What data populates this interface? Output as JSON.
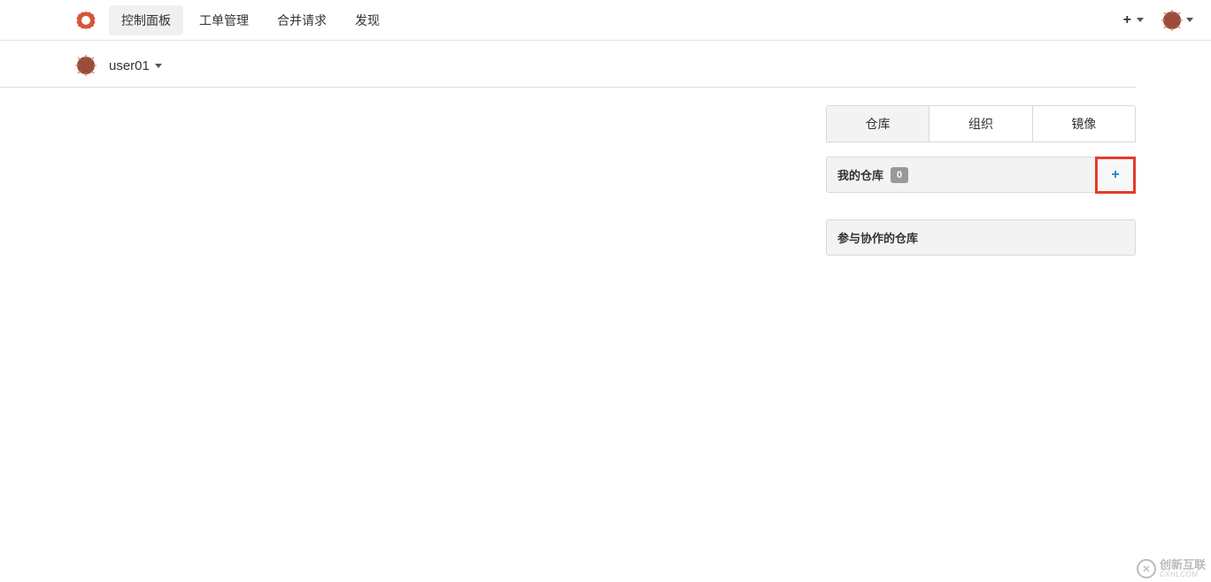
{
  "nav": {
    "items": [
      "控制面板",
      "工单管理",
      "合并请求",
      "发现"
    ],
    "active_index": 0
  },
  "user": {
    "name": "user01"
  },
  "tabs": {
    "items": [
      "仓库",
      "组织",
      "镜像"
    ],
    "active_index": 0
  },
  "panels": {
    "my_repos": {
      "label": "我的仓库",
      "count": "0"
    },
    "collab": {
      "label": "参与协作的仓库"
    }
  },
  "watermark": {
    "text": "创新互联",
    "sub": "CXHLCOM"
  }
}
